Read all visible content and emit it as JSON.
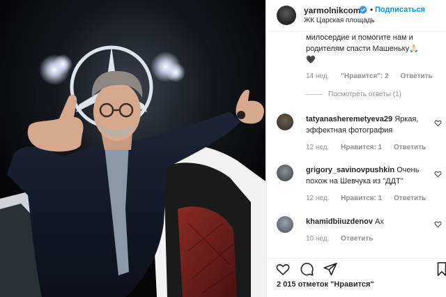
{
  "post": {
    "username": "yarmolnikcom",
    "dot": "•",
    "follow_label": "Подписаться",
    "location": "ЖК Царская площадь"
  },
  "caption": {
    "line1": "милосердие и помогите нам и",
    "line2": "родителям спасти Машеньку",
    "emoji": "🙏🏻",
    "line3": "🖤",
    "time": "14 нед.",
    "likes": "\"Нравится\": 2",
    "reply": "Ответить",
    "view_replies": "Посмотреть ответы (1)"
  },
  "comments": [
    {
      "username": "tatyanasheremetyeva29",
      "text": "Яркая, эффектная фотография",
      "time": "12 нед.",
      "likes": "Нравится: 1",
      "reply": "Ответить"
    },
    {
      "username": "grigory_savinovpushkin",
      "text": "Очень похож на Шевчука из \"ДДТ\"",
      "time": "12 нед.",
      "likes": "Нравится: 1",
      "reply": "Ответить"
    },
    {
      "username": "khamidbiiuzdenov",
      "text": "Ах",
      "time": "10 нед.",
      "likes": "",
      "reply": "Ответить"
    }
  ],
  "footer": {
    "likes_count": "2 015 отметок",
    "likes_label": "\"Нравится\""
  },
  "icons": [
    "verified-badge-icon",
    "heart-icon",
    "comment-icon",
    "share-icon",
    "bookmark-icon",
    "small-heart-icon"
  ],
  "colors": {
    "accent": "#0095f6",
    "muted": "#8e8e8e",
    "text": "#262626",
    "border": "#efefef"
  }
}
